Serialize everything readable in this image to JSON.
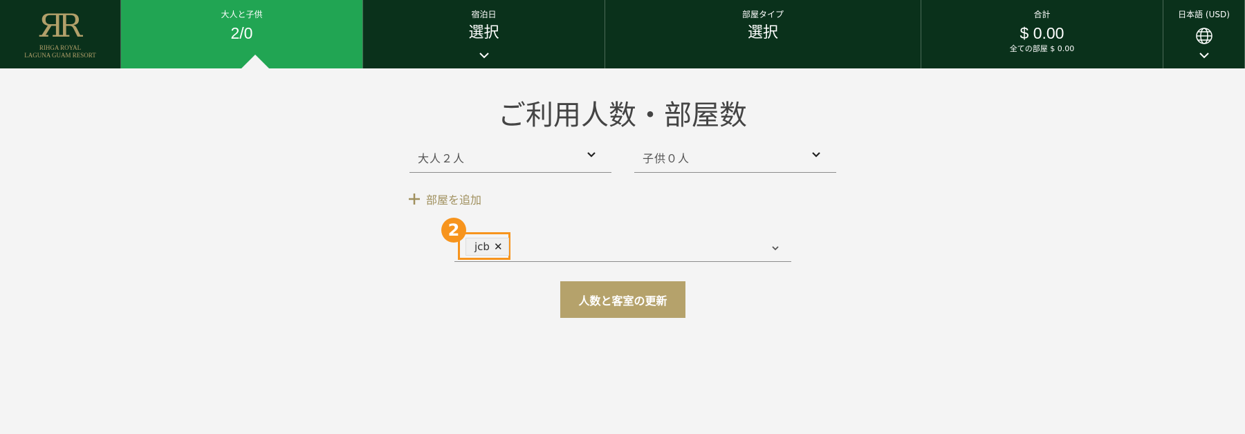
{
  "logo": {
    "line1": "RIHGA ROYAL",
    "line2": "LAGUNA GUAM RESORT"
  },
  "nav": {
    "guests": {
      "label": "大人と子供",
      "value": "2/0"
    },
    "dates": {
      "label": "宿泊日",
      "value": "選択"
    },
    "room_type": {
      "label": "部屋タイプ",
      "value": "選択"
    },
    "total": {
      "label": "合計",
      "value": "$ 0.00",
      "sub": "全ての部屋 $ 0.00"
    },
    "language": {
      "label": "日本語 (USD)"
    }
  },
  "page_title": "ご利用人数・部屋数",
  "adults_select": {
    "value": "大人２人"
  },
  "children_select": {
    "value": "子供０人"
  },
  "add_room_label": "部屋を追加",
  "card_select": {
    "tag": "jcb",
    "tag_close": "✕"
  },
  "step_badge": "2",
  "update_button_label": "人数と客室の更新",
  "colors": {
    "header_bg": "#0a311b",
    "active_tab": "#21a553",
    "gold": "#b5a26b",
    "highlight": "#f7941d"
  }
}
